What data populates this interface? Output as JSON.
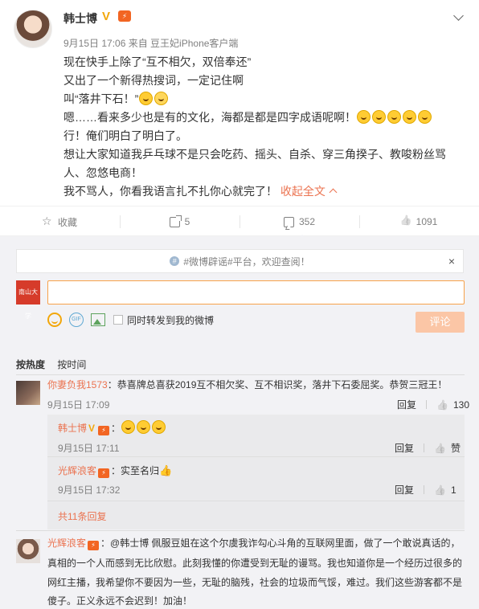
{
  "post": {
    "author": "韩士博",
    "verified_badge": "V",
    "meta": "9月15日 17:06 来自 豆王妃iPhone客户端",
    "lines": [
      "现在快手上除了“互不相欠，双倍奉还”",
      "又出了一个新得热搜词，一定记住啊",
      "叫“落井下石！”",
      "嗯……看来多少也是有的文化，海都是都是四字成语呢啊！",
      "行！俺们明白了明白了。",
      "想让大家知道我乒乓球不是只会吃药、摇头、自杀、穿三角揆子、教唆粉丝骂",
      "人、忽悠电商！",
      "我不骂人，你看我语言扎不扎你心就完了！"
    ],
    "collapse_label": "收起全文"
  },
  "actions": {
    "favorite": "收藏",
    "forward": "5",
    "comment": "352",
    "like": "1091"
  },
  "comment_box": {
    "notice": "#微博辟谣#平台，欢迎查阅！",
    "notice_close": "×",
    "my_avatar_text": "南山大学",
    "share_label": "同时转发到我的微博",
    "submit": "评论",
    "gif": "GIF"
  },
  "sort": {
    "by_hot": "按热度",
    "by_time": "按时间"
  },
  "comments": [
    {
      "author": "你妻负我1573",
      "text": "：恭喜牌总喜获2019互不相欠奖、互不相识奖，落井下石委屈奖。恭贺三冠王！",
      "time": "9月15日 17:09",
      "reply": "回复",
      "likes": "130",
      "replies": [
        {
          "author": "韩士博",
          "text": "：",
          "time": "9月15日 17:11",
          "reply": "回复",
          "likes": "赞"
        },
        {
          "author": "光辉浪客",
          "text": "：实至名归",
          "time": "9月15日 17:32",
          "reply": "回复",
          "likes": "1"
        }
      ],
      "more": "共11条回复"
    },
    {
      "author": "光辉浪客",
      "lines": [
        "：@韩士博 佩服豆姐在这个尔虞我诈勾心斗角的互联网里面，做了一个敢说真话的，",
        "真相的一个人而感到无比欣慰。此刻我懂的你遭受到无耻的谩骂。我也知道你是一个经历过很多的",
        "网红主播，我希望你不要因为一些，无耻的脑残，社会的垃圾而气馁，难过。我们这些游客都不是",
        "傻子。正义永远不会迟到！加油！"
      ]
    }
  ],
  "colors": {
    "accent": "#eb7350",
    "verified": "#f2a70b",
    "input_border": "#f7a14a",
    "submit_bg": "#fbc6a6",
    "panel_bg": "#f2f2f5"
  }
}
